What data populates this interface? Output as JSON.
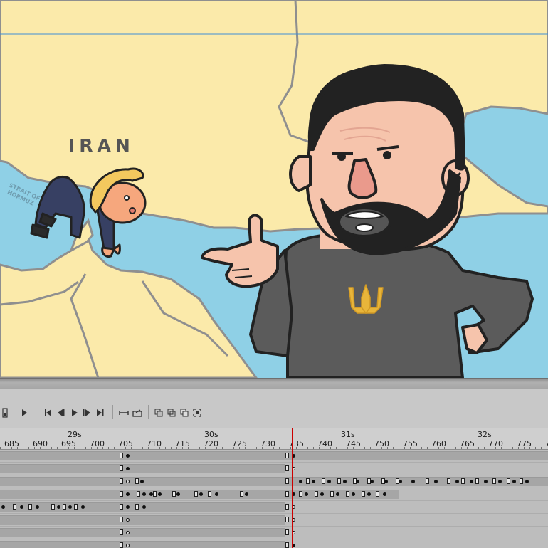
{
  "stage": {
    "map_labels": {
      "iran": "IRAN",
      "strait_line1": "STRAIT OF",
      "strait_line2": "HORMUZ"
    },
    "colors": {
      "land": "#fbeaaa",
      "water": "#8fd0e6",
      "border": "#8f8f8f",
      "sweater": "#5b5b5b",
      "skin": "#f6c4ac",
      "hair": "#222222",
      "emblem": "#e8b53a"
    }
  },
  "timeline": {
    "seconds": [
      "29s",
      "30s",
      "31s",
      "32s"
    ],
    "frames": [
      "685",
      "690",
      "695",
      "700",
      "705",
      "710",
      "715",
      "720",
      "725",
      "730",
      "735",
      "740",
      "745",
      "750",
      "755",
      "760",
      "765",
      "770",
      "775",
      "7"
    ],
    "toolbar_icons": [
      "frame-icon",
      "play-icon",
      "go-start-icon",
      "step-back-icon",
      "play-icon",
      "step-forward-icon",
      "go-end-icon",
      "loop-icon",
      "export-icon",
      "onion-skin-icon",
      "onion-outline-icon",
      "edit-multiple-icon",
      "onion-markers-icon"
    ],
    "track_count": 8
  }
}
